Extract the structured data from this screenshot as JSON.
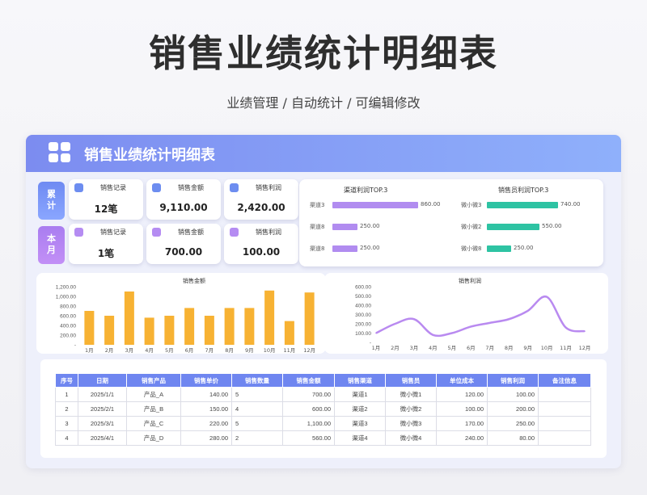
{
  "page": {
    "title": "销售业绩统计明细表",
    "subtitle": "业绩管理 / 自动统计 / 可编辑修改"
  },
  "banner": {
    "title": "销售业绩统计明细表"
  },
  "summary": {
    "cumulative": {
      "label": "累\n计",
      "cards": [
        {
          "label": "销售记录",
          "value": "12笔",
          "icon": "document-icon"
        },
        {
          "label": "销售金额",
          "value": "9,110.00",
          "icon": "trend-icon"
        },
        {
          "label": "销售利润",
          "value": "2,420.00",
          "icon": "coins-icon"
        }
      ]
    },
    "month": {
      "label": "本\n月",
      "cards": [
        {
          "label": "销售记录",
          "value": "1笔",
          "icon": "bulb-icon"
        },
        {
          "label": "销售金额",
          "value": "700.00",
          "icon": "image-icon"
        },
        {
          "label": "销售利润",
          "value": "100.00",
          "icon": "grid-icon"
        }
      ]
    }
  },
  "top_channel": {
    "title": "渠道利润TOP.3",
    "items": [
      {
        "name": "渠道3",
        "value": 860,
        "label": "860.00"
      },
      {
        "name": "渠道8",
        "value": 250,
        "label": "250.00"
      },
      {
        "name": "渠道8",
        "value": 250,
        "label": "250.00"
      }
    ],
    "color": "#b18cf0"
  },
  "top_seller": {
    "title": "销售员利润TOP.3",
    "items": [
      {
        "name": "微小微3",
        "value": 740,
        "label": "740.00"
      },
      {
        "name": "微小微2",
        "value": 550,
        "label": "550.00"
      },
      {
        "name": "微小微8",
        "value": 250,
        "label": "250.00"
      }
    ],
    "color": "#2ec3a3"
  },
  "chart_data": [
    {
      "type": "bar",
      "title": "销售金额",
      "categories": [
        "1月",
        "2月",
        "3月",
        "4月",
        "5月",
        "6月",
        "7月",
        "8月",
        "9月",
        "10月",
        "11月",
        "12月"
      ],
      "values": [
        700,
        600,
        1100,
        560,
        600,
        760,
        600,
        760,
        760,
        1120,
        490,
        1080
      ],
      "ylim": [
        0,
        1200
      ],
      "yticks": [
        "-",
        "200.00",
        "400.00",
        "600.00",
        "800.00",
        "1,000.00",
        "1,200.00"
      ],
      "color": "#f7b233"
    },
    {
      "type": "line",
      "title": "销售利润",
      "categories": [
        "1月",
        "2月",
        "3月",
        "4月",
        "5月",
        "6月",
        "7月",
        "8月",
        "9月",
        "10月",
        "11月",
        "12月"
      ],
      "values": [
        100,
        200,
        250,
        80,
        100,
        170,
        210,
        250,
        340,
        490,
        160,
        120
      ],
      "ylim": [
        0,
        600
      ],
      "yticks": [
        "-",
        "100.00",
        "200.00",
        "300.00",
        "400.00",
        "500.00",
        "600.00"
      ],
      "color": "#b98af0"
    }
  ],
  "table": {
    "headers": [
      "序号",
      "日期",
      "销售产品",
      "销售单价",
      "销售数量",
      "销售金额",
      "销售渠道",
      "销售员",
      "单位成本",
      "销售利润",
      "备注信息"
    ],
    "rows": [
      [
        "1",
        "2025/1/1",
        "产品_A",
        "140.00",
        "5",
        "700.00",
        "渠道1",
        "微小微1",
        "120.00",
        "100.00",
        ""
      ],
      [
        "2",
        "2025/2/1",
        "产品_B",
        "150.00",
        "4",
        "600.00",
        "渠道2",
        "微小微2",
        "100.00",
        "200.00",
        ""
      ],
      [
        "3",
        "2025/3/1",
        "产品_C",
        "220.00",
        "5",
        "1,100.00",
        "渠道3",
        "微小微3",
        "170.00",
        "250.00",
        ""
      ],
      [
        "4",
        "2025/4/1",
        "产品_D",
        "280.00",
        "2",
        "560.00",
        "渠道4",
        "微小微4",
        "240.00",
        "80.00",
        ""
      ]
    ]
  }
}
